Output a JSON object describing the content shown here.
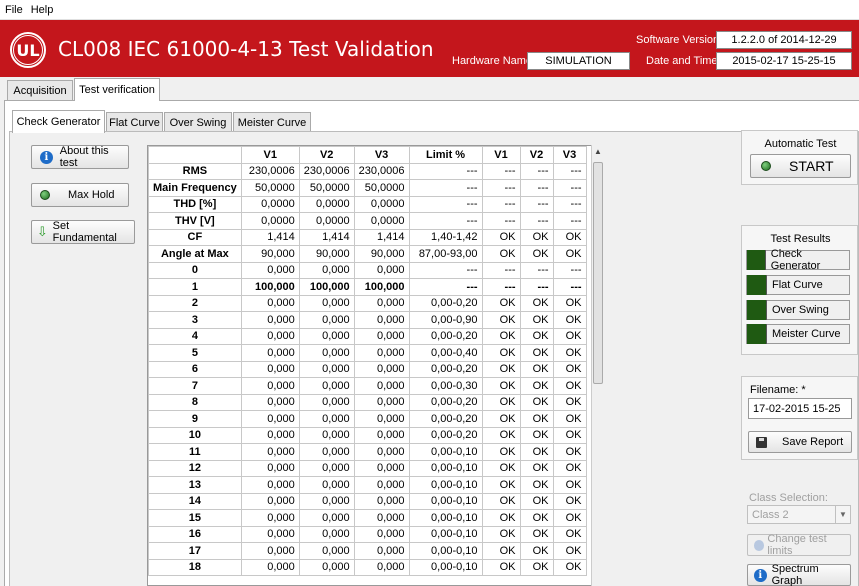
{
  "menu": [
    "File",
    "Help"
  ],
  "header": {
    "logo_text": "UL",
    "title": "CL008 IEC 61000-4-13 Test Validation",
    "hardware_label": "Hardware Name:",
    "hardware_value": "SIMULATION",
    "software_label": "Software Version:",
    "software_value": "1.2.2.0 of 2014-12-29",
    "datetime_label": "Date and Time:",
    "datetime_value": "2015-02-17 15-25-15"
  },
  "main_tabs": [
    "Acquisition",
    "Test verification"
  ],
  "sub_tabs": [
    "Check Generator",
    "Flat Curve",
    "Over Swing",
    "Meister Curve"
  ],
  "left_buttons": {
    "about": "About this test",
    "max_hold": "Max Hold",
    "set_fundamental": "Set Fundamental"
  },
  "table": {
    "headers": [
      "",
      "V1",
      "V2",
      "V3",
      "Limit %",
      "V1",
      "V2",
      "V3"
    ],
    "rows": [
      [
        "RMS",
        "230,0006",
        "230,0006",
        "230,0006",
        "---",
        "---",
        "---",
        "---"
      ],
      [
        "Main Frequency",
        "50,0000",
        "50,0000",
        "50,0000",
        "---",
        "---",
        "---",
        "---"
      ],
      [
        "THD [%]",
        "0,0000",
        "0,0000",
        "0,0000",
        "---",
        "---",
        "---",
        "---"
      ],
      [
        "THV [V]",
        "0,0000",
        "0,0000",
        "0,0000",
        "---",
        "---",
        "---",
        "---"
      ],
      [
        "CF",
        "1,414",
        "1,414",
        "1,414",
        "1,40-1,42",
        "OK",
        "OK",
        "OK"
      ],
      [
        "Angle at Max",
        "90,000",
        "90,000",
        "90,000",
        "87,00-93,00",
        "OK",
        "OK",
        "OK"
      ],
      [
        "0",
        "0,000",
        "0,000",
        "0,000",
        "---",
        "---",
        "---",
        "---"
      ],
      [
        "1",
        "100,000",
        "100,000",
        "100,000",
        "---",
        "---",
        "---",
        "---"
      ],
      [
        "2",
        "0,000",
        "0,000",
        "0,000",
        "0,00-0,20",
        "OK",
        "OK",
        "OK"
      ],
      [
        "3",
        "0,000",
        "0,000",
        "0,000",
        "0,00-0,90",
        "OK",
        "OK",
        "OK"
      ],
      [
        "4",
        "0,000",
        "0,000",
        "0,000",
        "0,00-0,20",
        "OK",
        "OK",
        "OK"
      ],
      [
        "5",
        "0,000",
        "0,000",
        "0,000",
        "0,00-0,40",
        "OK",
        "OK",
        "OK"
      ],
      [
        "6",
        "0,000",
        "0,000",
        "0,000",
        "0,00-0,20",
        "OK",
        "OK",
        "OK"
      ],
      [
        "7",
        "0,000",
        "0,000",
        "0,000",
        "0,00-0,30",
        "OK",
        "OK",
        "OK"
      ],
      [
        "8",
        "0,000",
        "0,000",
        "0,000",
        "0,00-0,20",
        "OK",
        "OK",
        "OK"
      ],
      [
        "9",
        "0,000",
        "0,000",
        "0,000",
        "0,00-0,20",
        "OK",
        "OK",
        "OK"
      ],
      [
        "10",
        "0,000",
        "0,000",
        "0,000",
        "0,00-0,20",
        "OK",
        "OK",
        "OK"
      ],
      [
        "11",
        "0,000",
        "0,000",
        "0,000",
        "0,00-0,10",
        "OK",
        "OK",
        "OK"
      ],
      [
        "12",
        "0,000",
        "0,000",
        "0,000",
        "0,00-0,10",
        "OK",
        "OK",
        "OK"
      ],
      [
        "13",
        "0,000",
        "0,000",
        "0,000",
        "0,00-0,10",
        "OK",
        "OK",
        "OK"
      ],
      [
        "14",
        "0,000",
        "0,000",
        "0,000",
        "0,00-0,10",
        "OK",
        "OK",
        "OK"
      ],
      [
        "15",
        "0,000",
        "0,000",
        "0,000",
        "0,00-0,10",
        "OK",
        "OK",
        "OK"
      ],
      [
        "16",
        "0,000",
        "0,000",
        "0,000",
        "0,00-0,10",
        "OK",
        "OK",
        "OK"
      ],
      [
        "17",
        "0,000",
        "0,000",
        "0,000",
        "0,00-0,10",
        "OK",
        "OK",
        "OK"
      ],
      [
        "18",
        "0,000",
        "0,000",
        "0,000",
        "0,00-0,10",
        "OK",
        "OK",
        "OK"
      ]
    ],
    "bold_row_label": "1"
  },
  "automatic_test": {
    "title": "Automatic Test",
    "start_label": "START"
  },
  "test_results": {
    "title": "Test Results",
    "items": [
      "Check Generator",
      "Flat Curve",
      "Over Swing",
      "Meister Curve"
    ],
    "led_color": "#1f5a12"
  },
  "report": {
    "filename_label": "Filename: *",
    "filename_value": "17-02-2015 15-25",
    "save_label": "Save Report"
  },
  "class_selection": {
    "label": "Class Selection:",
    "value": "Class 2",
    "change_limits_label": "Change test limits",
    "spectrum_label": "Spectrum Graph"
  },
  "colors": {
    "brand": "#c4161c",
    "led_green": "#1f5a12"
  }
}
